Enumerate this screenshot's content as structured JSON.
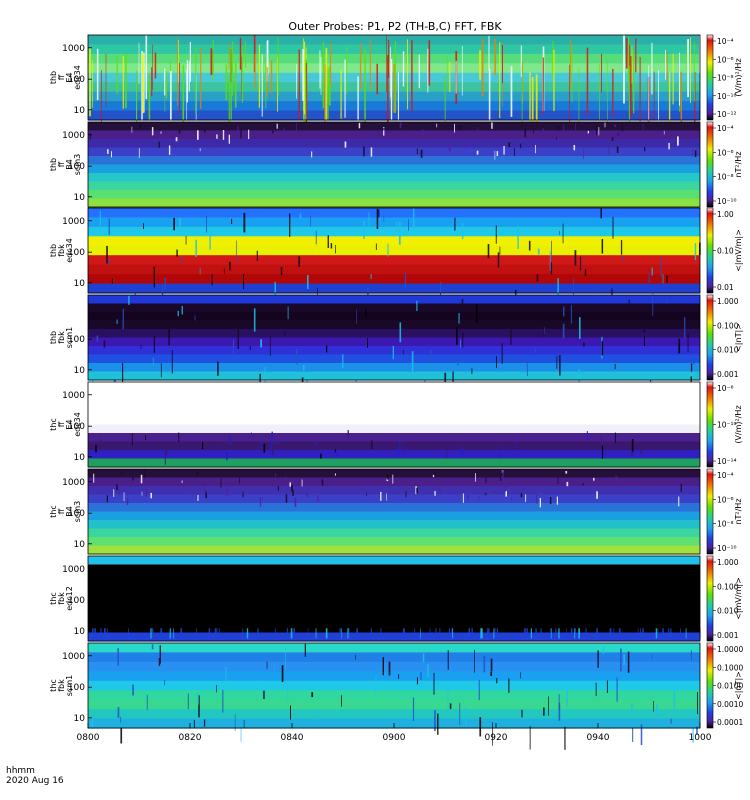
{
  "title": "Outer Probes: P1, P2 (TH-B,C) FFT, FBK",
  "footer": {
    "unit_label": "hhmm",
    "date_label": "2020 Aug 16"
  },
  "chart_data": {
    "type": "heatmap",
    "x_ticks": [
      "0800",
      "0820",
      "0840",
      "0900",
      "0920",
      "0940",
      "1000"
    ],
    "x_range": [
      "0800",
      "1000"
    ],
    "panels": [
      {
        "id": "thb-ff-e4-edc34",
        "ylabel": [
          "thb",
          "ff",
          "E4",
          "edc34"
        ],
        "yticks": [
          "10",
          "100",
          "1000"
        ],
        "scale": "log",
        "cbar_ticks": [
          "10⁻⁴",
          "10⁻⁶",
          "10⁻⁸",
          "10⁻¹⁰",
          "10⁻¹²"
        ],
        "cbar_label": "(V/m)²/Hz",
        "bands": [
          "#2ab0a8",
          "#2fc6a4",
          "#56dc7a",
          "#7fe88c",
          "#48c9d8",
          "#3ec3a0",
          "#2aa0c8",
          "#1a7ad8",
          "#2452c8"
        ],
        "note": "vertical bright streaks (white / yellow / red bursts)"
      },
      {
        "id": "thb-ff-b4-scm3",
        "ylabel": [
          "thb",
          "ff",
          "B4",
          "scm3"
        ],
        "yticks": [
          "10",
          "100",
          "1000"
        ],
        "scale": "log",
        "cbar_ticks": [
          "10⁻⁴",
          "10⁻⁶",
          "10⁻⁸",
          "10⁻¹⁰"
        ],
        "cbar_label": "nT²/Hz",
        "bands": [
          "#24103a",
          "#4a1f8a",
          "#3d2aa8",
          "#3a40c8",
          "#2a72d8",
          "#1aa0e0",
          "#25c6c8",
          "#3bd5a0",
          "#58e070",
          "#8ce040"
        ]
      },
      {
        "id": "thb-fbk-e34",
        "ylabel": [
          "thb",
          "fbk",
          "edc34"
        ],
        "yticks": [
          "10",
          "100",
          "1000"
        ],
        "scale": "log",
        "cbar_ticks": [
          "1.00",
          "0.10",
          "0.01"
        ],
        "cbar_label": "<|mV/m|>",
        "bands": [
          "#2470ff",
          "#1aa0f0",
          "#20c8e8",
          "#f0f000",
          "#e8f000",
          "#d01818",
          "#c01010",
          "#b00808",
          "#2040d0"
        ]
      },
      {
        "id": "thb-fbk-scm1",
        "ylabel": [
          "thb",
          "fbk",
          "scm1"
        ],
        "yticks": [
          "10",
          "100"
        ],
        "scale": "log",
        "cbar_ticks": [
          "1.000",
          "0.100",
          "0.010",
          "0.001"
        ],
        "cbar_label": "<|nT|>",
        "bands": [
          "#2038d8",
          "#1a0828",
          "#140420",
          "#1a0828",
          "#2a1060",
          "#3c18b0",
          "#3030d8",
          "#2050e0",
          "#1a90e8",
          "#20c0d8"
        ]
      },
      {
        "id": "thc-ff-e4-edc34",
        "ylabel": [
          "thc",
          "ff",
          "E4",
          "edc34"
        ],
        "yticks": [
          "10",
          "100",
          "1000"
        ],
        "scale": "log",
        "cbar_ticks": [
          "10⁻⁶",
          "10⁻¹⁰",
          "10⁻¹⁴"
        ],
        "cbar_label": "(V/m)²/Hz",
        "bands": [
          "#ffffff",
          "#ffffff",
          "#ffffff",
          "#ffffff",
          "#ffffff",
          "#f0f0f8",
          "#4a2090",
          "#3a1870",
          "#3020c0",
          "#20a060"
        ]
      },
      {
        "id": "thc-ff-b4-scm3",
        "ylabel": [
          "thc",
          "ff",
          "B4",
          "scm3"
        ],
        "yticks": [
          "10",
          "100",
          "1000"
        ],
        "scale": "log",
        "cbar_ticks": [
          "10⁻⁴",
          "10⁻⁶",
          "10⁻⁸",
          "10⁻¹⁰"
        ],
        "cbar_label": "nT²/Hz",
        "bands": [
          "#24103a",
          "#4a1f8a",
          "#4030b0",
          "#3a40c8",
          "#2a72d8",
          "#1aa0e0",
          "#22c0c8",
          "#3bd5a0",
          "#60e070",
          "#a0e040"
        ]
      },
      {
        "id": "thc-fbk-edc12",
        "ylabel": [
          "thc",
          "fbk",
          "edc12"
        ],
        "yticks": [
          "10",
          "100",
          "1000"
        ],
        "scale": "log",
        "cbar_ticks": [
          "1.000",
          "0.100",
          "0.010",
          "0.001"
        ],
        "cbar_label": "<|mV/m|>",
        "bands": [
          "#20c0e8",
          "#000000",
          "#000000",
          "#000000",
          "#000000",
          "#000000",
          "#000000",
          "#000000",
          "#000000",
          "#2040d8"
        ]
      },
      {
        "id": "thc-fbk-scm1",
        "ylabel": [
          "thc",
          "fbk",
          "scm1"
        ],
        "yticks": [
          "10",
          "100",
          "1000"
        ],
        "scale": "log",
        "cbar_ticks": [
          "1.0000",
          "0.1000",
          "0.0100",
          "0.0010",
          "0.0001"
        ],
        "cbar_label": "<|nT|>",
        "bands": [
          "#28d8c8",
          "#2080e8",
          "#2890f0",
          "#1aa0f0",
          "#20c8e8",
          "#30d8a0",
          "#38d890",
          "#22c8c0",
          "#20b0e0"
        ]
      }
    ],
    "colorbar_colors": [
      "#ffffff",
      "#e01010",
      "#f08000",
      "#f0f000",
      "#60e000",
      "#20d0a0",
      "#20a0f0",
      "#2040e0",
      "#5020a0",
      "#000000"
    ]
  }
}
